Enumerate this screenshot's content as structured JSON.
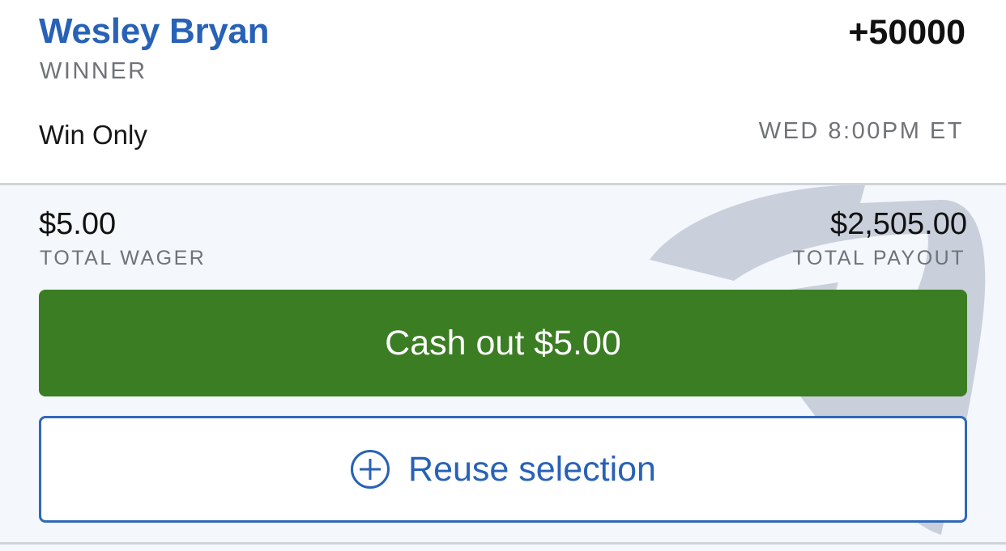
{
  "selection": {
    "name": "Wesley Bryan",
    "odds": "+50000",
    "market": "WINNER",
    "bet_type": "Win Only",
    "event_time": "WED 8:00PM ET"
  },
  "bet": {
    "wager_amount": "$5.00",
    "wager_label": "TOTAL WAGER",
    "payout_amount": "$2,505.00",
    "payout_label": "TOTAL PAYOUT"
  },
  "actions": {
    "cashout_label": "Cash out $5.00",
    "reuse_label": "Reuse selection",
    "reuse_icon": "plus-circle-icon"
  },
  "colors": {
    "brand_blue": "#2862b7",
    "cashout_green": "#3b7d23",
    "muted_text": "#6f7378",
    "panel_background": "#f4f7fb",
    "watermark": "#c9d0dc"
  }
}
